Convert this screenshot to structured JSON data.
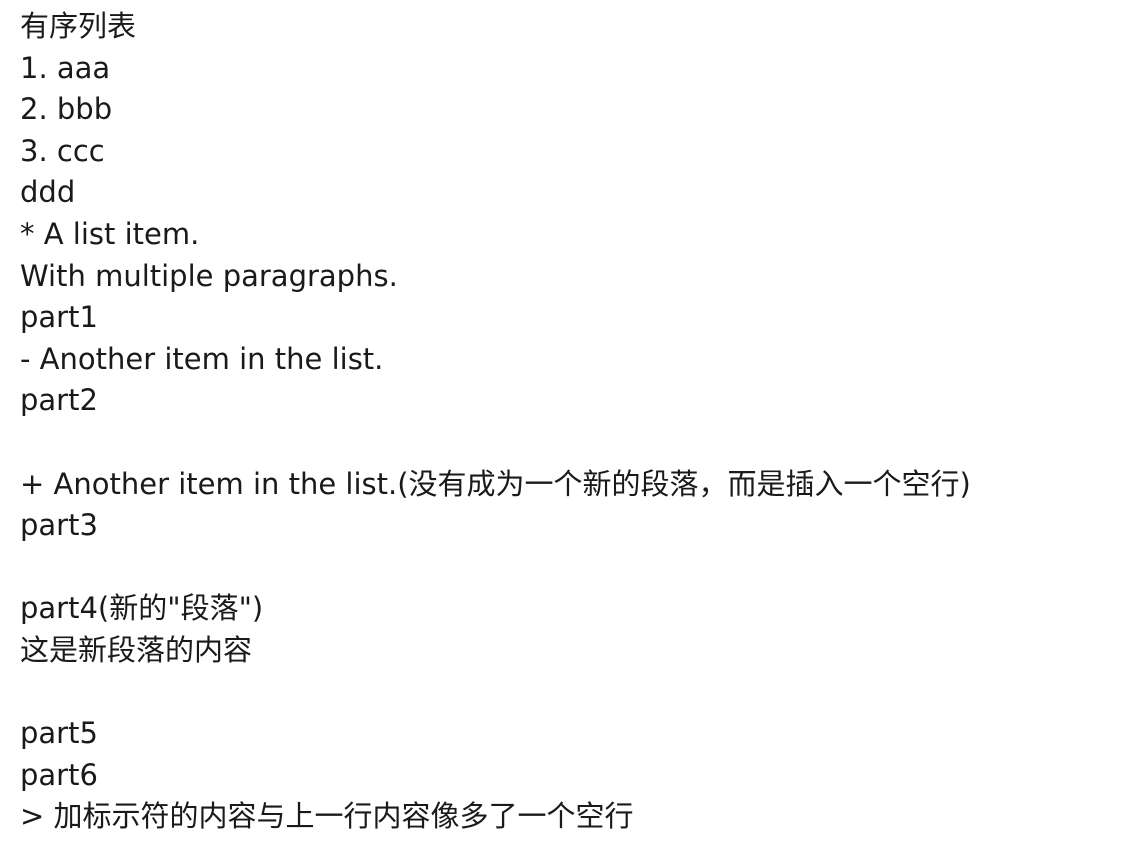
{
  "document": {
    "lines": [
      "有序列表",
      "1. aaa",
      "2. bbb",
      "3. ccc",
      "ddd",
      "* A list item.",
      "With multiple paragraphs.",
      "part1",
      "- Another item in the list.",
      "part2",
      "",
      "+ Another item in the list.(没有成为一个新的段落，而是插入一个空行)",
      "part3",
      "",
      "part4(新的\"段落\")",
      "这是新段落的内容",
      "",
      "part5",
      "part6",
      "> 加标示符的内容与上一行内容像多了一个空行"
    ]
  }
}
